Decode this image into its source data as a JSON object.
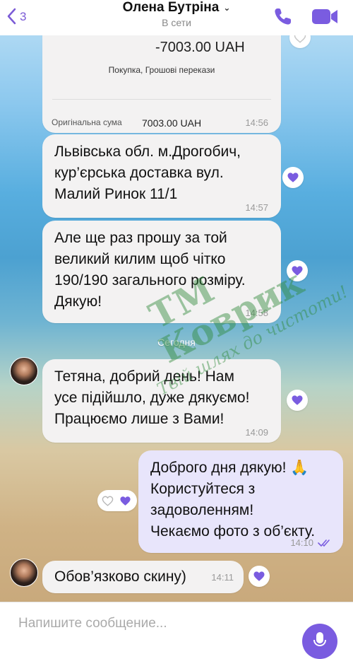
{
  "header": {
    "back_count": "3",
    "contact_name": "Олена Бутріна",
    "status": "В сети"
  },
  "transaction": {
    "amount": "-7003.00 UAH",
    "category": "Покупка, Грошові перекази",
    "original_label": "Оригінальна сума",
    "original_value": "7003.00 UAH",
    "time": "14:56"
  },
  "messages": [
    {
      "direction": "in",
      "text": "Львівська обл. м.Дрогобич,\nкур’єрська доставка вул.\nМалий Ринок 11/1",
      "time": "14:57"
    },
    {
      "direction": "in",
      "text": "Але ще раз прошу за той\nвеликий килим щоб чітко\n190/190 загального розміру.\nДякую!",
      "time": "14:58"
    },
    {
      "direction": "in",
      "text": "Тетяна, добрий день! Нам\nусе підійшло, дуже дякуємо!\nПрацюємо лише з Вами!",
      "time": "14:09"
    },
    {
      "direction": "out",
      "text": "Доброго дня дякую! 🙏\nКористуйтеся з\nзадоволенням!\nЧекаємо фото з об’єкту.",
      "time": "14:10"
    },
    {
      "direction": "in",
      "text": "Обов’язково скину)",
      "time": "14:11"
    }
  ],
  "date_separator": "Сегодня",
  "composer": {
    "placeholder": "Напишите сообщение..."
  },
  "watermark": {
    "mark": "ТМ",
    "brand": "Коврик",
    "slogan": "Твій шлях до чистоти!"
  },
  "colors": {
    "accent": "#7a5ce0",
    "bubble_in": "#f3f2f2",
    "bubble_out": "#e8e5fb",
    "watermark": "#2f8a3a"
  },
  "icons": [
    "back-chevron-icon",
    "chevron-down-icon",
    "phone-icon",
    "video-camera-icon",
    "heart-icon",
    "double-check-icon",
    "microphone-icon"
  ]
}
